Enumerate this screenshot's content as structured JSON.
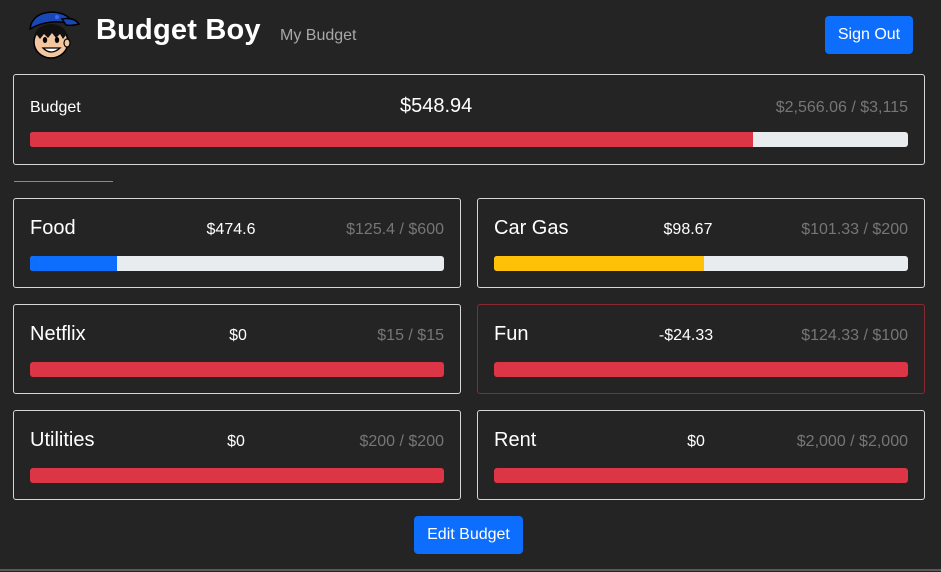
{
  "header": {
    "brand": "Budget Boy",
    "nav_link": "My Budget",
    "sign_out_label": "Sign Out"
  },
  "colors": {
    "primary": "#0d6efd",
    "danger": "#dc3545",
    "warning": "#ffc107",
    "track": "#e9ecef",
    "background": "#242424"
  },
  "overall": {
    "label": "Budget",
    "remaining": "$548.94",
    "spent_of_total": "$2,566.06 / $3,115",
    "progress_fraction": 0.824,
    "bar_color": "danger"
  },
  "categories": [
    {
      "name": "Food",
      "remaining": "$474.6",
      "spent_of_total": "$125.4 / $600",
      "progress_fraction": 0.209,
      "bar_color": "primary",
      "over_budget": false
    },
    {
      "name": "Car Gas",
      "remaining": "$98.67",
      "spent_of_total": "$101.33 / $200",
      "progress_fraction": 0.507,
      "bar_color": "warning",
      "over_budget": false
    },
    {
      "name": "Netflix",
      "remaining": "$0",
      "spent_of_total": "$15 / $15",
      "progress_fraction": 1.0,
      "bar_color": "danger",
      "over_budget": false
    },
    {
      "name": "Fun",
      "remaining": "-$24.33",
      "spent_of_total": "$124.33 / $100",
      "progress_fraction": 1.0,
      "bar_color": "danger",
      "over_budget": true
    },
    {
      "name": "Utilities",
      "remaining": "$0",
      "spent_of_total": "$200 / $200",
      "progress_fraction": 1.0,
      "bar_color": "danger",
      "over_budget": false
    },
    {
      "name": "Rent",
      "remaining": "$0",
      "spent_of_total": "$2,000 / $2,000",
      "progress_fraction": 1.0,
      "bar_color": "danger",
      "over_budget": false
    }
  ],
  "footer": {
    "edit_label": "Edit Budget"
  }
}
